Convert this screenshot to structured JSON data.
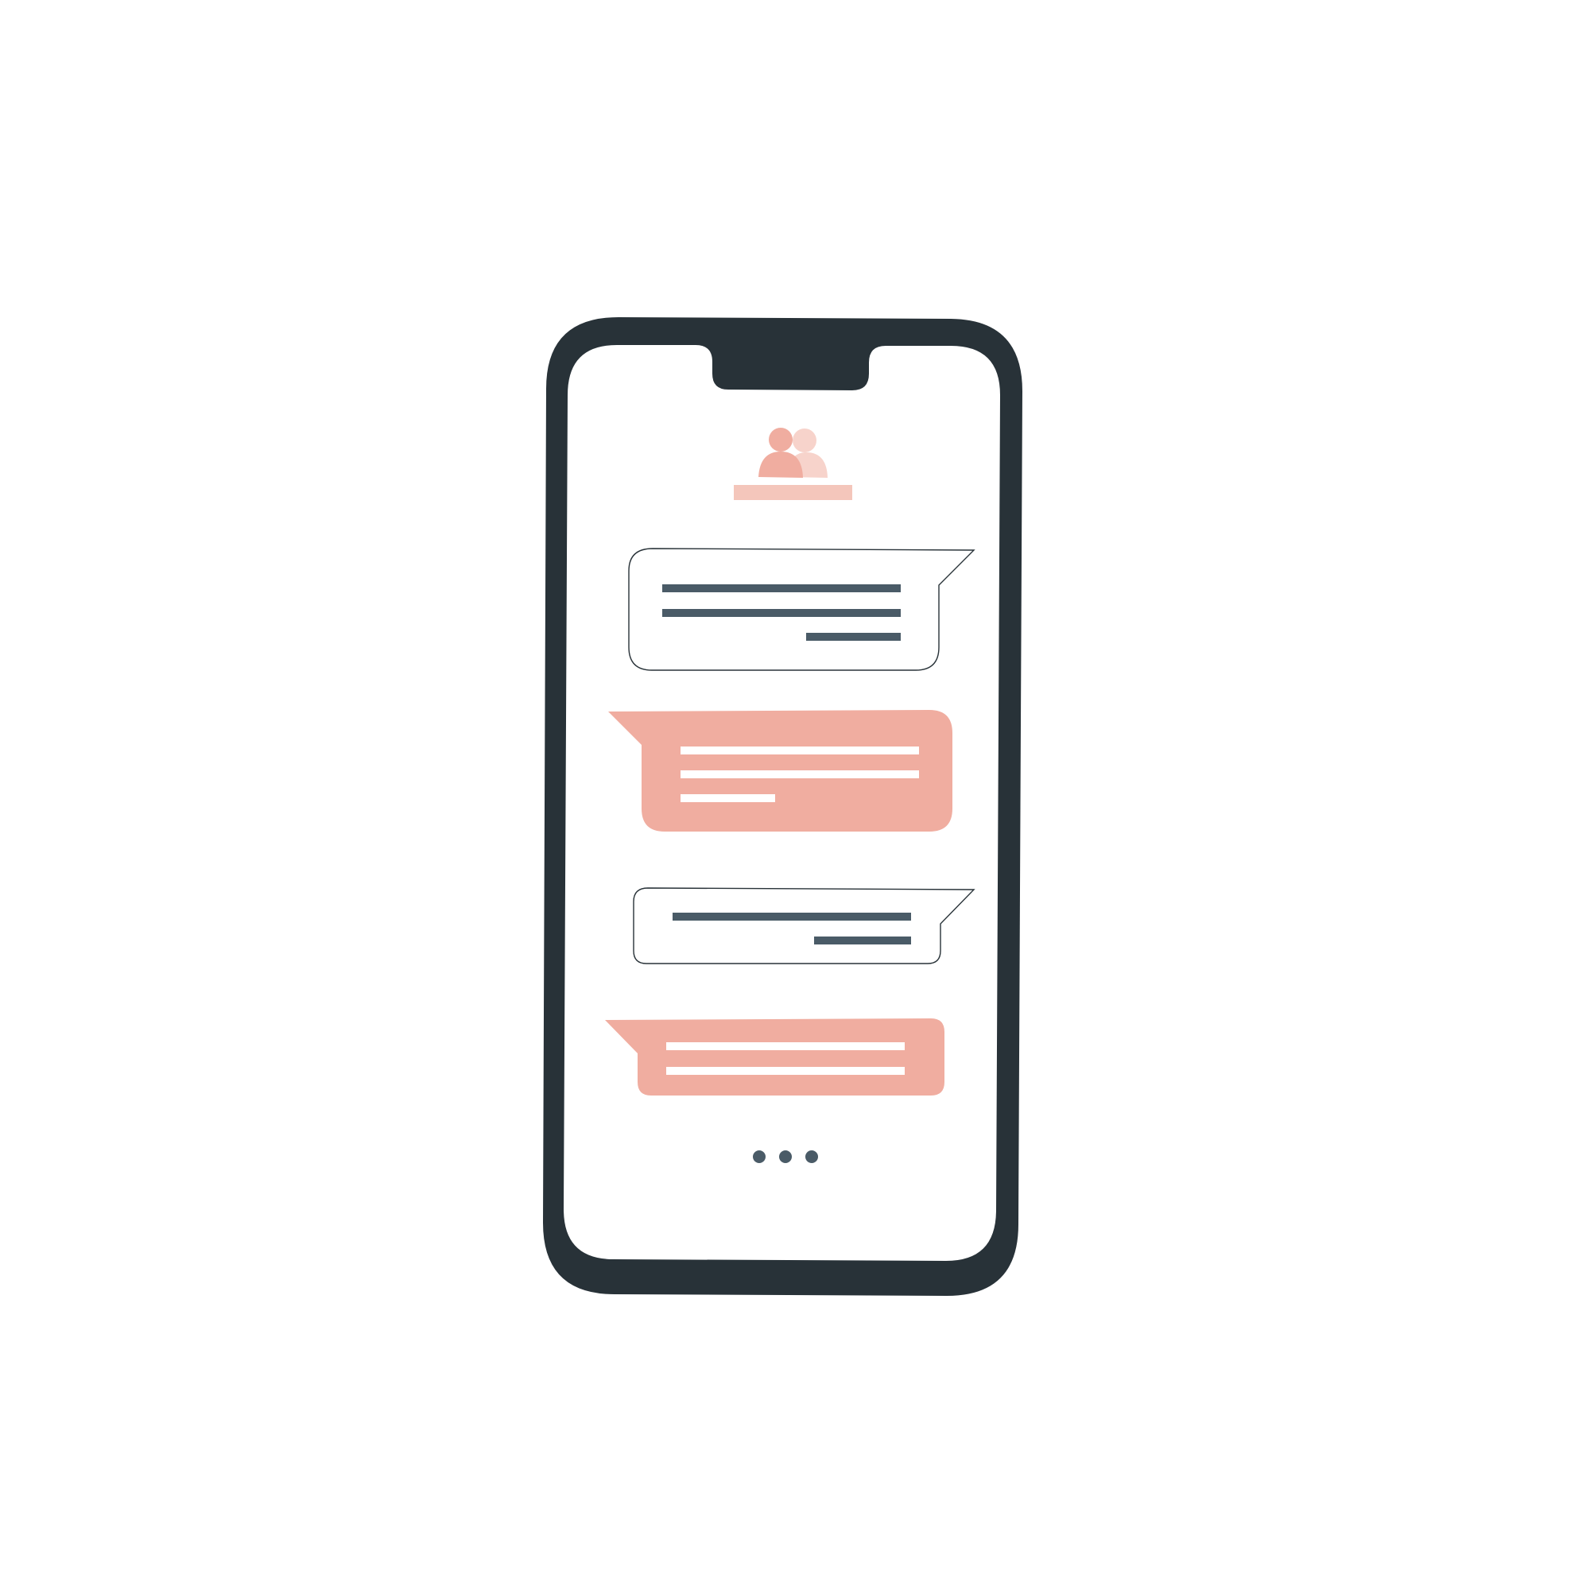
{
  "illustration": {
    "subject": "phone-chat-conversation",
    "colors": {
      "background": "#ffffff",
      "phone_frame": "#283238",
      "screen": "#ffffff",
      "accent_primary": "#f0ada0",
      "accent_light": "#f7d3cb",
      "accent_bar": "#f4c6bb",
      "text_line_dark": "#4a5b67",
      "text_line_light": "#ffffff",
      "outline": "#283238"
    },
    "icons": {
      "contacts": "users-icon",
      "typing": "typing-indicator-icon"
    },
    "messages": [
      {
        "sender": "outgoing",
        "style": "outlined",
        "line_count": 3
      },
      {
        "sender": "incoming",
        "style": "filled",
        "line_count": 3
      },
      {
        "sender": "outgoing",
        "style": "outlined",
        "line_count": 2
      },
      {
        "sender": "incoming",
        "style": "filled",
        "line_count": 2
      }
    ],
    "typing_indicator_dots": 3
  }
}
